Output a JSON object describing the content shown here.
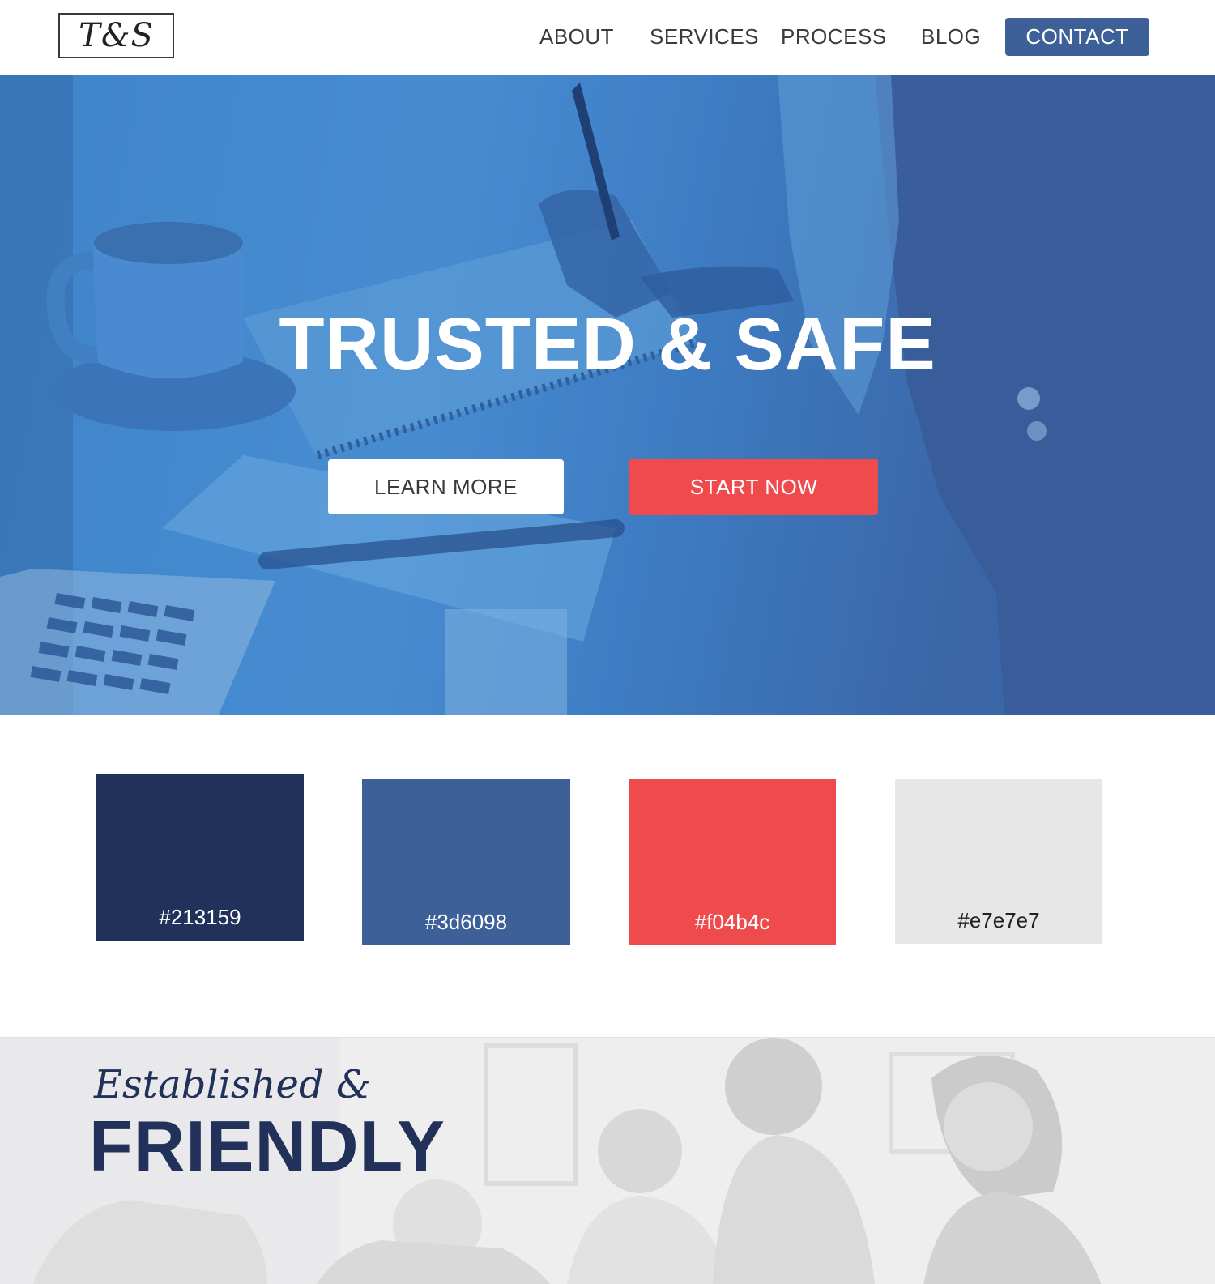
{
  "header": {
    "logo_text": "T&S",
    "nav": {
      "about": "ABOUT",
      "services": "SERVICES",
      "process": "PROCESS",
      "blog": "BLOG",
      "contact": "CONTACT"
    }
  },
  "hero": {
    "title": "TRUSTED & SAFE",
    "learn_more": "LEARN MORE",
    "start_now": "START NOW"
  },
  "palette": {
    "swatches": [
      {
        "label": "#213159",
        "color": "#213159"
      },
      {
        "label": "#3d6098",
        "color": "#3d6098"
      },
      {
        "label": "#f04b4c",
        "color": "#f04b4c"
      },
      {
        "label": "#e7e7e7",
        "color": "#e7e7e7"
      }
    ]
  },
  "about": {
    "script": "Established &",
    "heading": "FRIENDLY"
  }
}
